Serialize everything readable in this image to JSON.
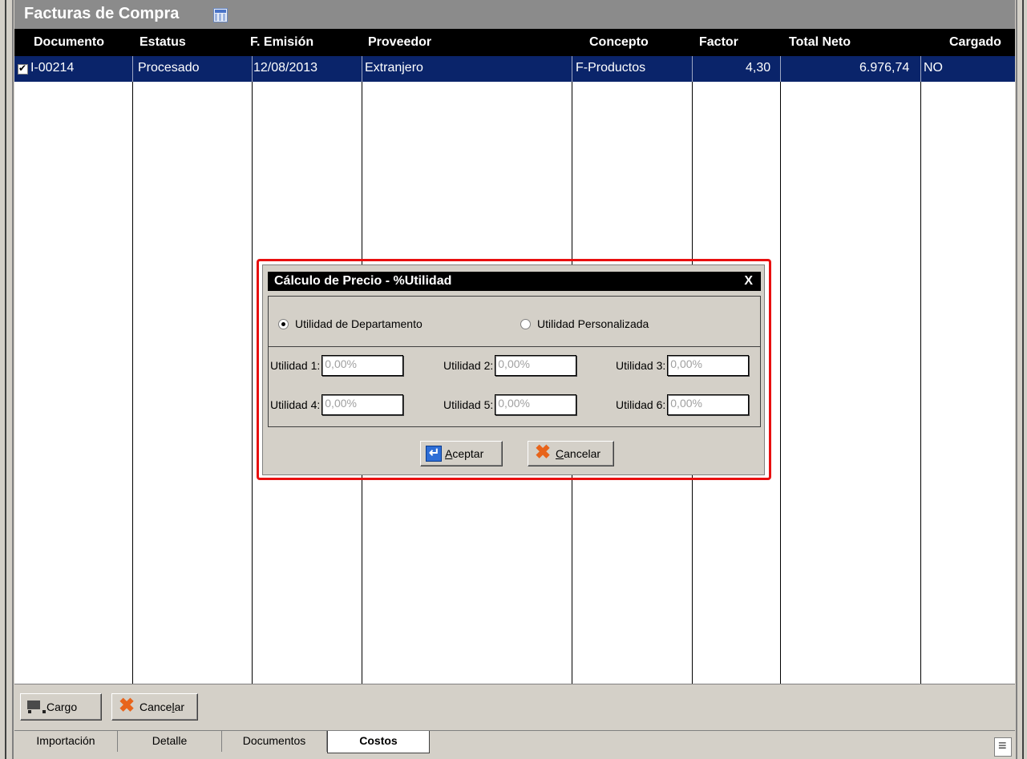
{
  "window": {
    "title": "Facturas de Compra"
  },
  "table": {
    "headers": [
      "Documento",
      "Estatus",
      "F. Emisión",
      "Proveedor",
      "Concepto",
      "Factor",
      "Total Neto",
      "Cargado"
    ],
    "rows": [
      {
        "checked": true,
        "documento": "I-00214",
        "estatus": "Procesado",
        "f_emision": "12/08/2013",
        "proveedor": "Extranjero",
        "concepto": "F-Productos",
        "factor": "4,30",
        "total_neto": "6.976,74",
        "cargado": "NO"
      }
    ]
  },
  "dialog": {
    "title": "Cálculo de Precio - %Utilidad",
    "close_label": "X",
    "radio_departamento": "Utilidad de Departamento",
    "radio_personalizada": "Utilidad Personalizada",
    "selected_radio": "departamento",
    "fields": [
      {
        "label": "Utilidad 1:",
        "value": "0,00%"
      },
      {
        "label": "Utilidad 2:",
        "value": "0,00%"
      },
      {
        "label": "Utilidad 3:",
        "value": "0,00%"
      },
      {
        "label": "Utilidad 4:",
        "value": "0,00%"
      },
      {
        "label": "Utilidad 5:",
        "value": "0,00%"
      },
      {
        "label": "Utilidad 6:",
        "value": "0,00%"
      }
    ],
    "accept_prefix": "",
    "accept_underlined": "A",
    "accept_rest": "ceptar",
    "cancel_underlined": "C",
    "cancel_rest": "ancelar"
  },
  "toolbar": {
    "cargo_label": "Cargo",
    "cancel_prefix": "Cance",
    "cancel_underlined": "l",
    "cancel_rest": "ar"
  },
  "tabs": [
    {
      "label": "Importación",
      "active": false
    },
    {
      "label": "Detalle",
      "active": false
    },
    {
      "label": "Documentos",
      "active": false
    },
    {
      "label": "Costos",
      "active": true
    }
  ],
  "colors": {
    "selection": "#0a246a",
    "header": "#000000",
    "highlight_border": "#e81010",
    "titlebar": "#8b8b8b"
  }
}
